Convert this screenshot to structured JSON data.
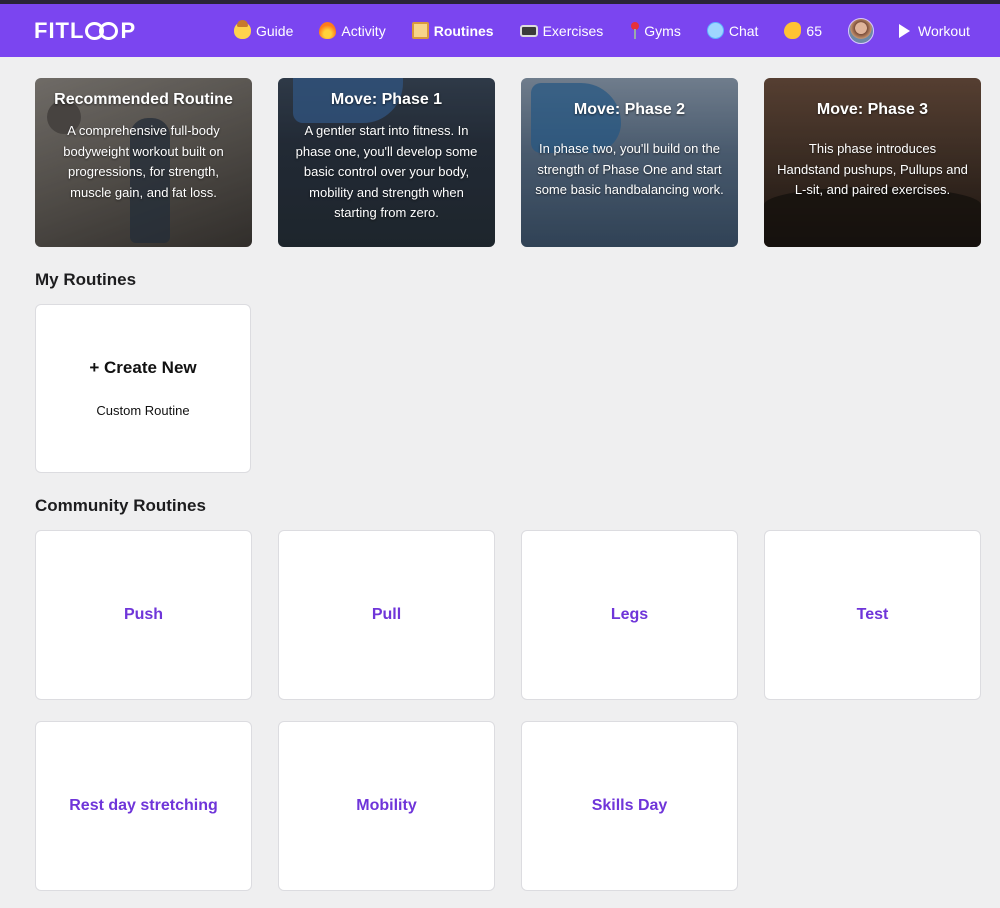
{
  "brand": {
    "name_left": "FITL",
    "name_right": "P"
  },
  "nav": {
    "items": [
      {
        "label": "Guide",
        "icon": "guide-emoji-icon"
      },
      {
        "label": "Activity",
        "icon": "fire-icon"
      },
      {
        "label": "Routines",
        "icon": "scroll-icon",
        "active": true
      },
      {
        "label": "Exercises",
        "icon": "video-icon"
      },
      {
        "label": "Gyms",
        "icon": "map-pin-icon"
      },
      {
        "label": "Chat",
        "icon": "chat-bubble-icon"
      },
      {
        "label": "65",
        "icon": "flexed-bicep-icon"
      }
    ],
    "workout_label": "Workout",
    "colors": {
      "bar": "#7b45f0",
      "accent_text": "#6f35d9"
    }
  },
  "featured": [
    {
      "title": "Recommended Routine",
      "desc": "A comprehensive full-body bodyweight workout built on progressions, for strength, muscle gain, and fat loss."
    },
    {
      "title": "Move: Phase 1",
      "desc": "A gentler start into fitness. In phase one, you'll develop some basic control over your body, mobility and strength when starting from zero."
    },
    {
      "title": "Move: Phase 2",
      "desc": "In phase two, you'll build on the strength of Phase One and start some basic handbalancing work."
    },
    {
      "title": "Move: Phase 3",
      "desc": "This phase introduces Handstand pushups, Pullups and L-sit, and paired exercises."
    }
  ],
  "my_routines": {
    "title": "My Routines",
    "create_label": "+ Create New",
    "create_sub": "Custom Routine"
  },
  "community": {
    "title": "Community Routines",
    "routines": [
      "Push",
      "Pull",
      "Legs",
      "Test",
      "Rest day stretching",
      "Mobility",
      "Skills Day"
    ]
  }
}
